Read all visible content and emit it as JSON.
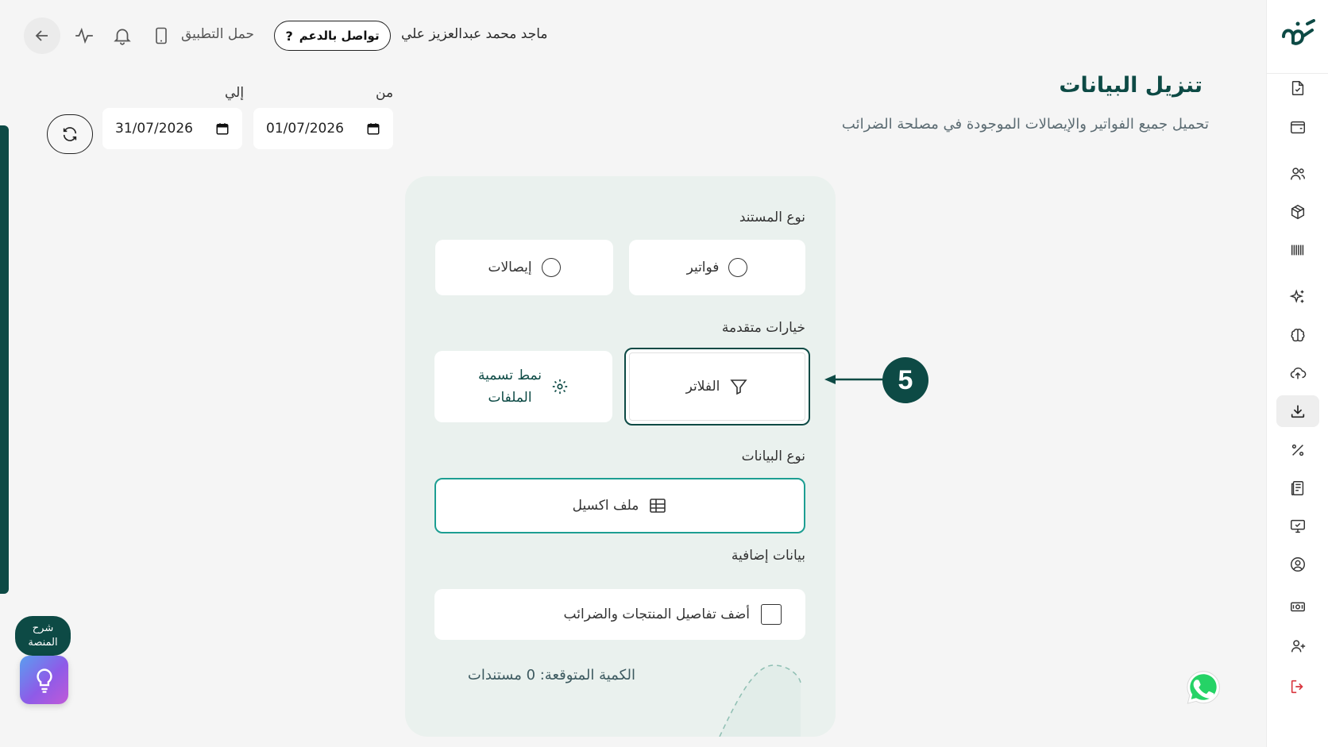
{
  "header": {
    "user_name": "ماجد محمد عبدالعزيز علي",
    "support_label": "تواصل بالدعم",
    "support_icon": "?",
    "app_download_label": "حمل التطبيق"
  },
  "page": {
    "title": "تنزيل البيانات",
    "subtitle": "تحميل جميع الفواتير والإيصالات الموجودة في مصلحة الضرائب"
  },
  "date_range": {
    "from_label": "من",
    "from_value": "01/07/2026",
    "to_label": "إلي",
    "to_value": "31/07/2026"
  },
  "form": {
    "doc_type_label": "نوع المستند",
    "doc_type_options": [
      "فواتير",
      "إيصالات"
    ],
    "advanced_label": "خيارات متقدمة",
    "filters_label": "الفلاتر",
    "naming_label_line1": "نمط تسمية",
    "naming_label_line2": "الملفات",
    "data_type_label": "نوع البيانات",
    "excel_label": "ملف اكسيل",
    "extra_label": "بيانات إضافية",
    "extra_checkbox_label": "أضف تفاصيل المنتجات والضرائب",
    "expected_count": "الكمية المتوقعة: 0 مستندات"
  },
  "step_badge": "5",
  "help": {
    "label_line1": "شرح",
    "label_line2": "المنصة"
  },
  "colors": {
    "brand": "#0d4a45",
    "accent": "#1d9e92",
    "panel_bg": "#eaf1ee",
    "logout": "#d9363e"
  },
  "sidebar_icons": [
    "document-check-icon",
    "wallet-icon",
    "users-icon",
    "package-icon",
    "barcode-icon",
    "sparkles-icon",
    "brain-icon",
    "cloud-upload-icon",
    "download-icon",
    "percent-icon",
    "receipt-icon",
    "monitor-check-icon",
    "user-circle-icon",
    "cash-icon",
    "user-plus-icon",
    "logout-icon"
  ]
}
